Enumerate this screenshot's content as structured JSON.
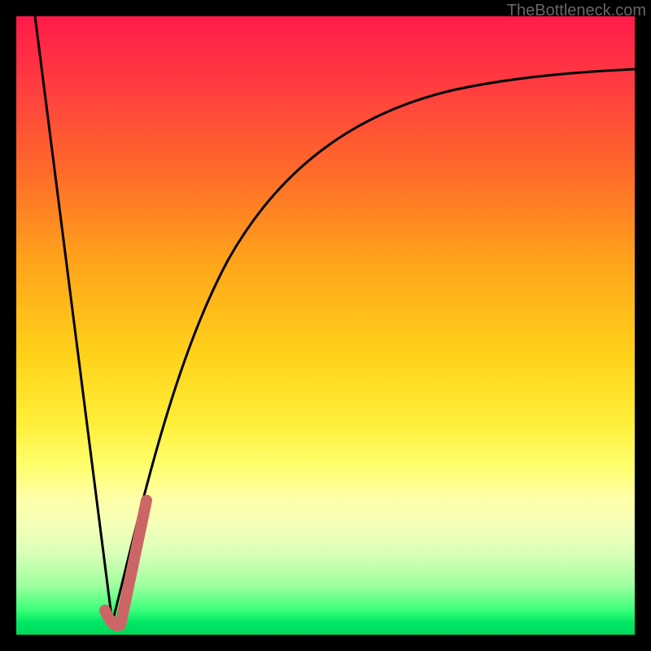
{
  "attribution": "TheBottleneck.com",
  "colors": {
    "background_border": "#000000",
    "gradient_top": "#ff1a4a",
    "gradient_mid": "#ffd21a",
    "gradient_bottom": "#00d85a",
    "curve_stroke": "#000000",
    "marker_stroke": "#cc6666"
  },
  "chart_data": {
    "type": "line",
    "title": "",
    "xlabel": "",
    "ylabel": "",
    "xlim": [
      0,
      100
    ],
    "ylim": [
      0,
      100
    ],
    "series": [
      {
        "name": "left-branch",
        "x": [
          3,
          15.5
        ],
        "values": [
          100,
          2
        ]
      },
      {
        "name": "right-branch",
        "x": [
          15.5,
          18,
          22,
          26,
          30,
          35,
          40,
          45,
          50,
          55,
          60,
          65,
          70,
          75,
          80,
          85,
          90,
          95,
          100
        ],
        "values": [
          2,
          14,
          30,
          42,
          52,
          61,
          67,
          72,
          76,
          79.5,
          82,
          84,
          85.5,
          87,
          88,
          89,
          89.8,
          90.5,
          91
        ]
      },
      {
        "name": "marker-segment",
        "x": [
          14.5,
          16.5,
          20.5
        ],
        "values": [
          4,
          3,
          22
        ]
      }
    ]
  }
}
